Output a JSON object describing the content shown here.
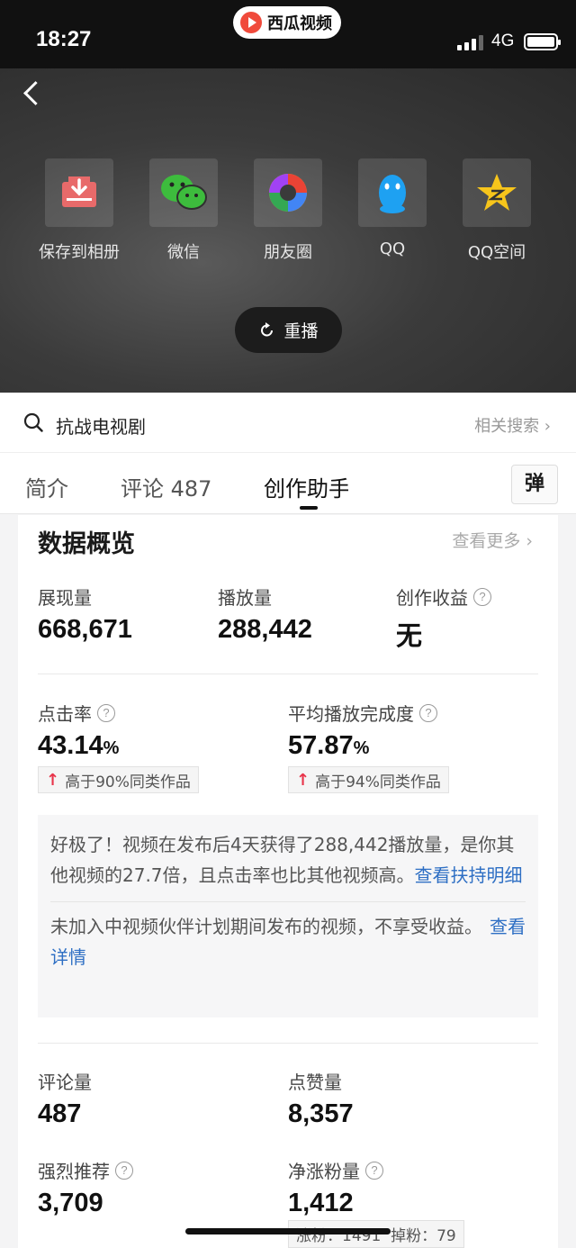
{
  "status_bar": {
    "time": "18:27",
    "app_pill": "西瓜视频",
    "network": "4G"
  },
  "share_panel": {
    "items": [
      {
        "label": "保存到相册",
        "icon": "save-to-album-icon"
      },
      {
        "label": "微信",
        "icon": "wechat-icon"
      },
      {
        "label": "朋友圈",
        "icon": "moments-icon"
      },
      {
        "label": "QQ",
        "icon": "qq-icon"
      },
      {
        "label": "QQ空间",
        "icon": "qzone-icon"
      }
    ],
    "replay_label": "重播"
  },
  "search": {
    "query": "抗战电视剧",
    "related_label": "相关搜索 ›"
  },
  "tabs": {
    "intro": "简介",
    "comments": "评论 487",
    "creator": "创作助手",
    "danmu": "弹"
  },
  "overview": {
    "title": "数据概览",
    "more_label": "查看更多 ›",
    "impressions": {
      "label": "展现量",
      "value": "668,671"
    },
    "plays": {
      "label": "播放量",
      "value": "288,442"
    },
    "earnings": {
      "label": "创作收益",
      "value": "无"
    },
    "ctr": {
      "label": "点击率",
      "value": "43.14",
      "unit": "%",
      "badge": "高于90%同类作品"
    },
    "completion": {
      "label": "平均播放完成度",
      "value": "57.87",
      "unit": "%",
      "badge": "高于94%同类作品"
    },
    "note": {
      "text1": "好极了！视频在发布后4天获得了288,442播放量，是你其他视频的27.7倍，且点击率也比其他视频高。",
      "link1": "查看扶持明细",
      "text2": "未加入中视频伙伴计划期间发布的视频，不享受收益。",
      "link2": "查看详情"
    },
    "comments": {
      "label": "评论量",
      "value": "487"
    },
    "likes": {
      "label": "点赞量",
      "value": "8,357"
    },
    "recommend": {
      "label": "强烈推荐",
      "value": "3,709"
    },
    "net_fans": {
      "label": "净涨粉量",
      "value": "1,412",
      "gain": "涨粉：1491",
      "loss": "掉粉：79"
    }
  },
  "colors": {
    "accent_red": "#e8344a",
    "link_blue": "#2e6fc4"
  }
}
